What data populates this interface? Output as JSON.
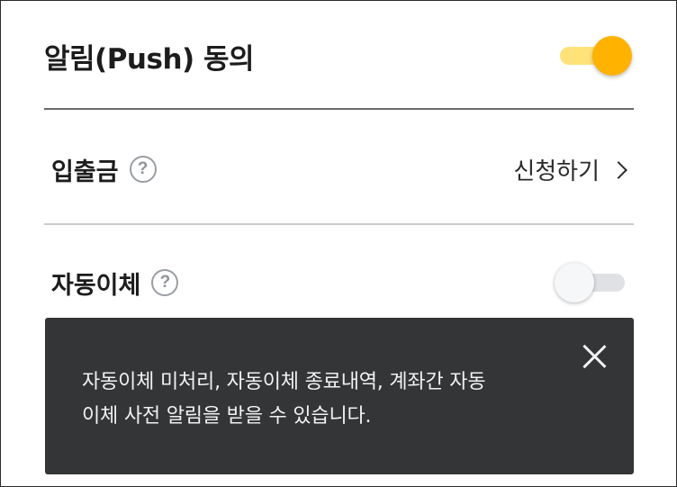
{
  "push_consent": {
    "label": "알림(Push) 동의",
    "toggle_state": "on",
    "accent_color": "#ffb200"
  },
  "deposit_withdrawal": {
    "label": "입출금",
    "help_icon": "?",
    "action_label": "신청하기"
  },
  "auto_transfer": {
    "label": "자동이체",
    "help_icon": "?",
    "toggle_state": "off"
  },
  "tooltip": {
    "text_line1": "자동이체 미처리, 자동이체 종료내역, 계좌간 자동",
    "text_line2": "이체 사전 알림을 받을 수 있습니다.",
    "close_icon": "close-icon"
  }
}
